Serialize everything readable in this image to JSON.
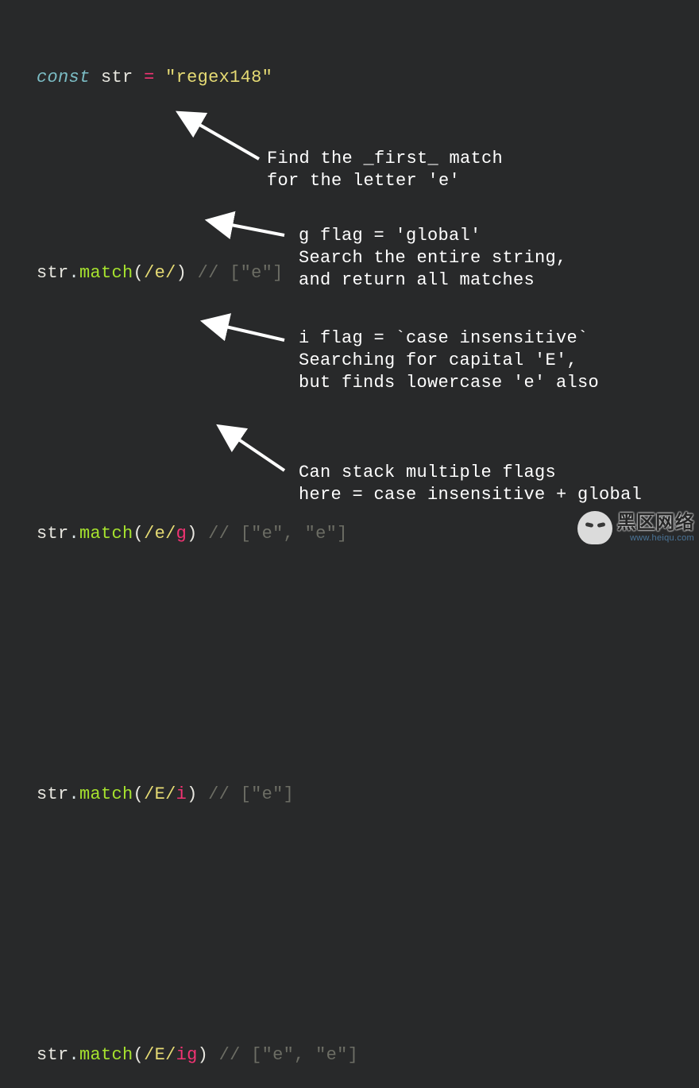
{
  "code": {
    "decl": {
      "keyword": "const",
      "ident": "str",
      "op": "=",
      "string": "\"regex148\""
    },
    "lines": [
      {
        "obj": "str",
        "method": "match",
        "open": "(",
        "regex": "/e/",
        "flag": "",
        "close": ")",
        "comment": "// [\"e\"]"
      },
      {
        "obj": "str",
        "method": "match",
        "open": "(",
        "regex": "/e/",
        "flag": "g",
        "close": ")",
        "comment": "// [\"e\", \"e\"]"
      },
      {
        "obj": "str",
        "method": "match",
        "open": "(",
        "regex": "/E/",
        "flag": "i",
        "close": ")",
        "comment": "// [\"e\"]"
      },
      {
        "obj": "str",
        "method": "match",
        "open": "(",
        "regex": "/E/",
        "flag": "ig",
        "close": ")",
        "comment": "// [\"e\", \"e\"]"
      }
    ]
  },
  "annotations": {
    "a1": "Find the _first_ match\nfor the letter 'e'",
    "a2": "g flag = 'global'\nSearch the entire string,\nand return all matches",
    "a3": "i flag = `case insensitive`\nSearching for capital 'E',\nbut finds lowercase 'e' also",
    "a4": "Can stack multiple flags\nhere = case insensitive + global"
  },
  "watermark": {
    "cn": "黑区网络",
    "url": "www.heiqu.com"
  }
}
